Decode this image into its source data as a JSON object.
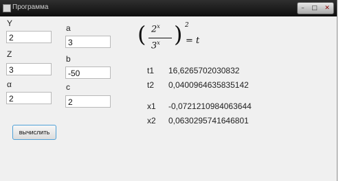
{
  "window": {
    "title": "Программа"
  },
  "inputs_left": [
    {
      "label": "Y",
      "value": "2"
    },
    {
      "label": "Z",
      "value": "3"
    },
    {
      "label": "α",
      "value": "2"
    }
  ],
  "inputs_mid": [
    {
      "label": "a",
      "value": "3"
    },
    {
      "label": "b",
      "value": "-50"
    },
    {
      "label": "c",
      "value": "2"
    }
  ],
  "button": {
    "label": "вычислить"
  },
  "formula": {
    "num_base": "2",
    "num_exp": "x",
    "den_base": "3",
    "den_exp": "x",
    "outer_exp": "2",
    "rhs": "= t"
  },
  "results": [
    {
      "name": "t1",
      "value": "16,6265702030832"
    },
    {
      "name": "t2",
      "value": "0,0400964635835142"
    },
    {
      "name": "x1",
      "value": "-0,0721210984063644"
    },
    {
      "name": "x2",
      "value": "0,0630295741646801"
    }
  ],
  "colors": {
    "titlebar": "#1a1a1a",
    "window_bg": "#f0f0f0",
    "button_border": "#4d9fd6"
  }
}
